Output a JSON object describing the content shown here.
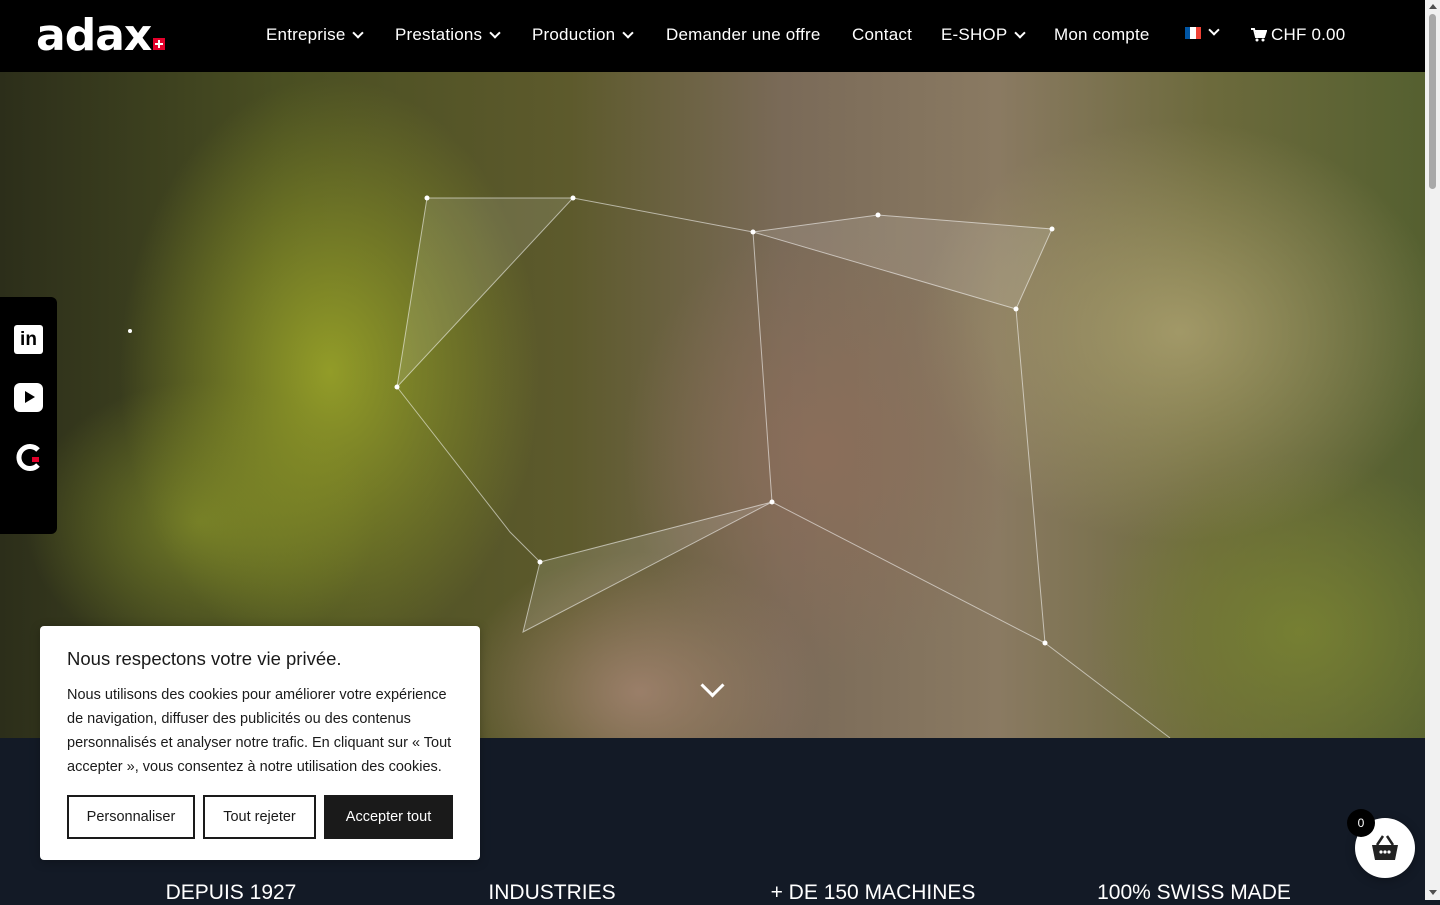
{
  "header": {
    "logo_text": "adax",
    "nav": [
      {
        "label": "Entreprise",
        "has_dropdown": true
      },
      {
        "label": "Prestations",
        "has_dropdown": true
      },
      {
        "label": "Production",
        "has_dropdown": true
      },
      {
        "label": "Demander une offre",
        "has_dropdown": false
      },
      {
        "label": "Contact",
        "has_dropdown": false
      },
      {
        "label": "E-SHOP",
        "has_dropdown": true
      },
      {
        "label": "Mon compte",
        "has_dropdown": false
      }
    ],
    "language_icon": "flag-fr-icon",
    "cart_label": "CHF 0.00"
  },
  "social": [
    {
      "icon": "linkedin-icon",
      "glyph": "in"
    },
    {
      "icon": "youtube-icon"
    },
    {
      "icon": "g-brand-icon"
    }
  ],
  "stats": [
    "DEPUIS 1927",
    "INDUSTRIES",
    "+ DE 150 MACHINES",
    "100% SWISS MADE"
  ],
  "cookie": {
    "title": "Nous respectons votre vie privée.",
    "text": "Nous utilisons des cookies pour améliorer votre expérience de navigation, diffuser des publicités ou des contenus personnalisés et analyser notre trafic. En cliquant sur « Tout accepter », vous consentez à notre utilisation des cookies.",
    "buttons": {
      "customize": "Personnaliser",
      "reject": "Tout rejeter",
      "accept": "Accepter tout"
    }
  },
  "basket": {
    "count": "0",
    "icon": "basket-icon"
  },
  "colors": {
    "header_bg": "#000000",
    "section_bg": "#131a26",
    "swiss_red": "#e4002b"
  }
}
